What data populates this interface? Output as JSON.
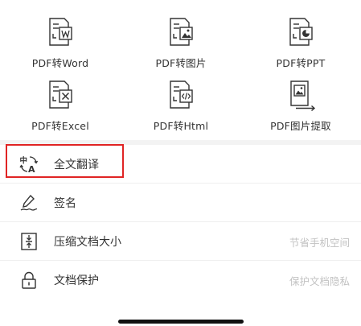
{
  "tools": [
    {
      "label": "PDF转Word",
      "icon": "pdf-to-word-icon"
    },
    {
      "label": "PDF转图片",
      "icon": "pdf-to-image-icon"
    },
    {
      "label": "PDF转PPT",
      "icon": "pdf-to-ppt-icon"
    },
    {
      "label": "PDF转Excel",
      "icon": "pdf-to-excel-icon"
    },
    {
      "label": "PDF转Html",
      "icon": "pdf-to-html-icon"
    },
    {
      "label": "PDF图片提取",
      "icon": "pdf-image-extract-icon"
    }
  ],
  "list": [
    {
      "label": "全文翻译",
      "hint": "",
      "icon": "translate-icon"
    },
    {
      "label": "签名",
      "hint": "",
      "icon": "signature-icon"
    },
    {
      "label": "压缩文档大小",
      "hint": "节省手机空间",
      "icon": "compress-icon"
    },
    {
      "label": "文档保护",
      "hint": "保护文档隐私",
      "icon": "lock-icon"
    }
  ],
  "colors": {
    "highlight": "#e02424",
    "icon": "#333333",
    "hint": "#c2c2c2"
  }
}
